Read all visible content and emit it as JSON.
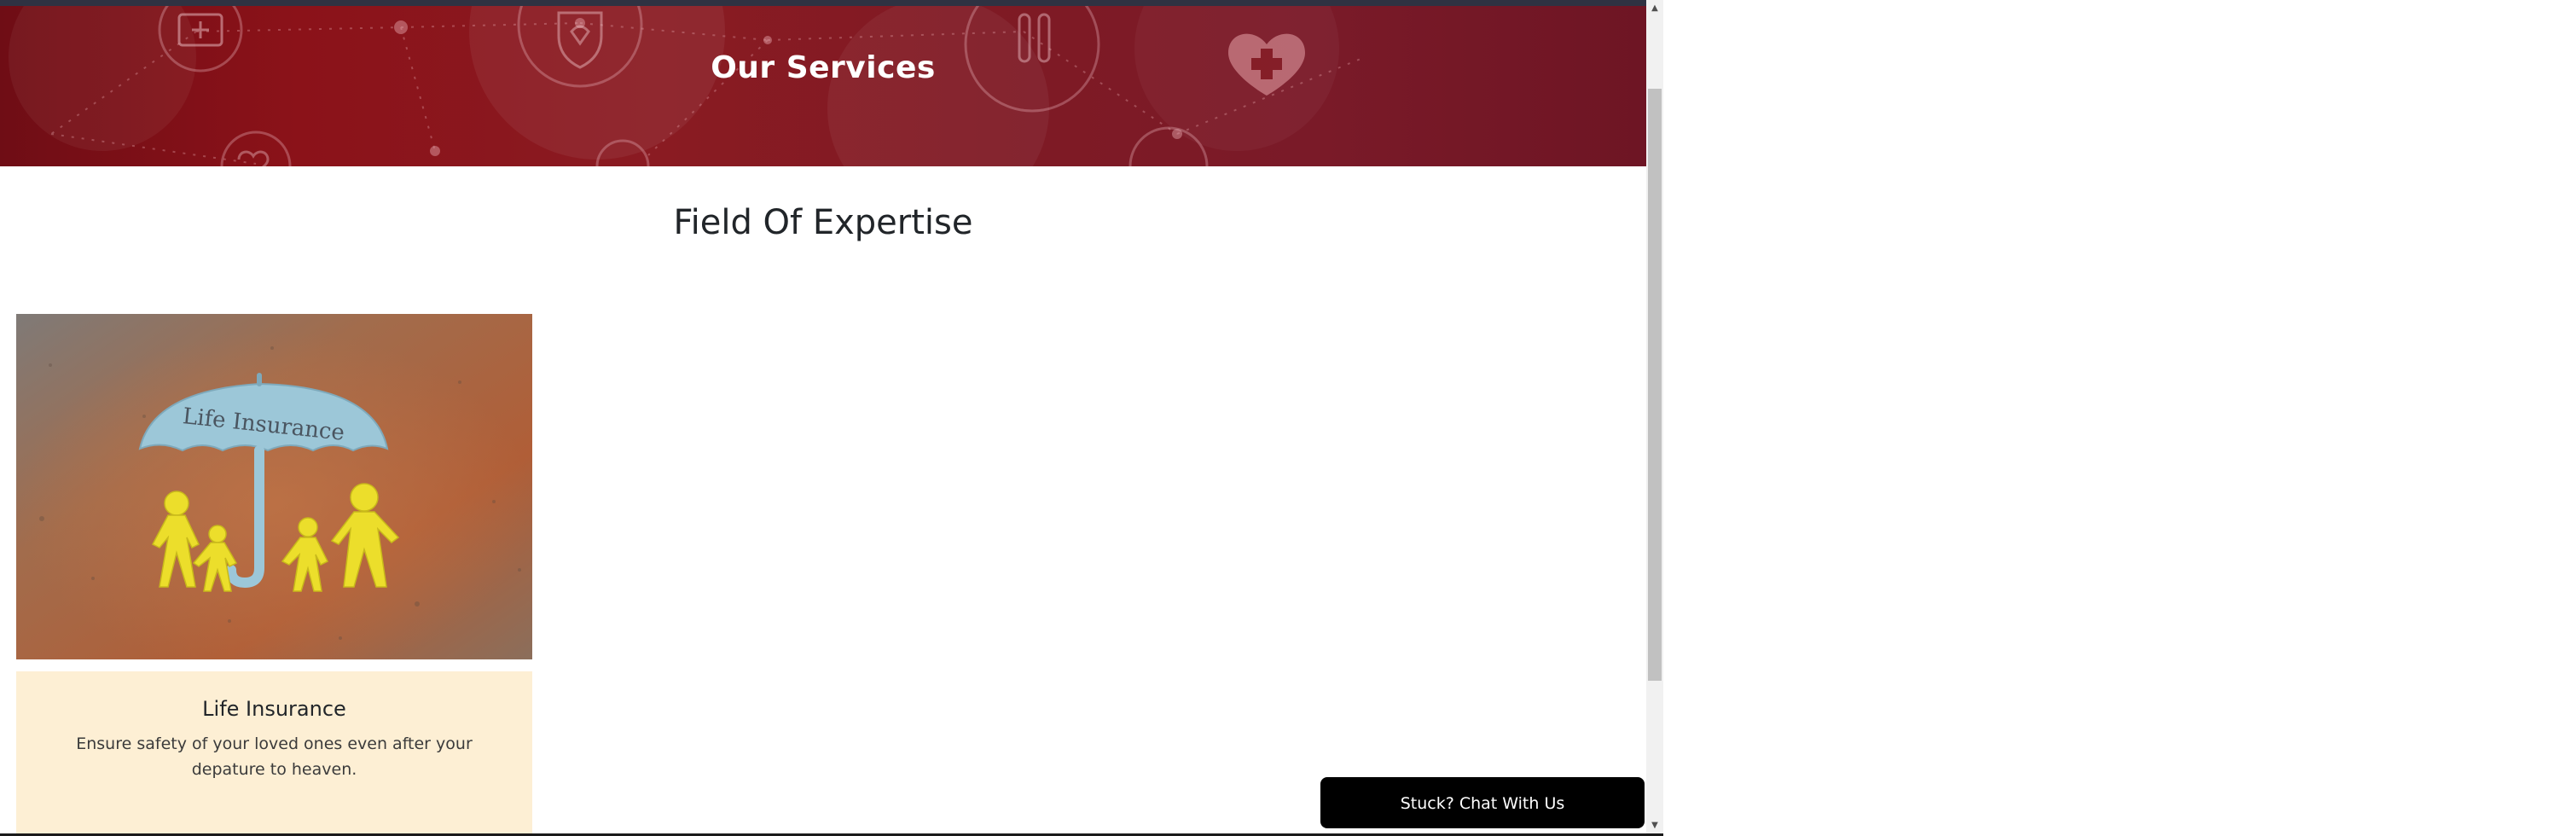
{
  "hero": {
    "title": "Our Services"
  },
  "section": {
    "heading": "Field Of Expertise"
  },
  "services": [
    {
      "image_text": "Life Insurance",
      "title": "Life Insurance",
      "description": "Ensure safety of your loved ones even after your depature to heaven."
    }
  ],
  "chat": {
    "label": "Stuck? Chat With Us"
  },
  "scrollbar": {
    "up_glyph": "▲",
    "down_glyph": "▼"
  },
  "colors": {
    "hero_background": "#7f1a24",
    "card_body_background": "#fdefd4",
    "chat_button": "#000000",
    "top_strip": "#2f3242"
  },
  "icons": [
    "medical-kit-icon",
    "heart-shield-icon",
    "test-tubes-icon",
    "heart-cross-icon"
  ]
}
